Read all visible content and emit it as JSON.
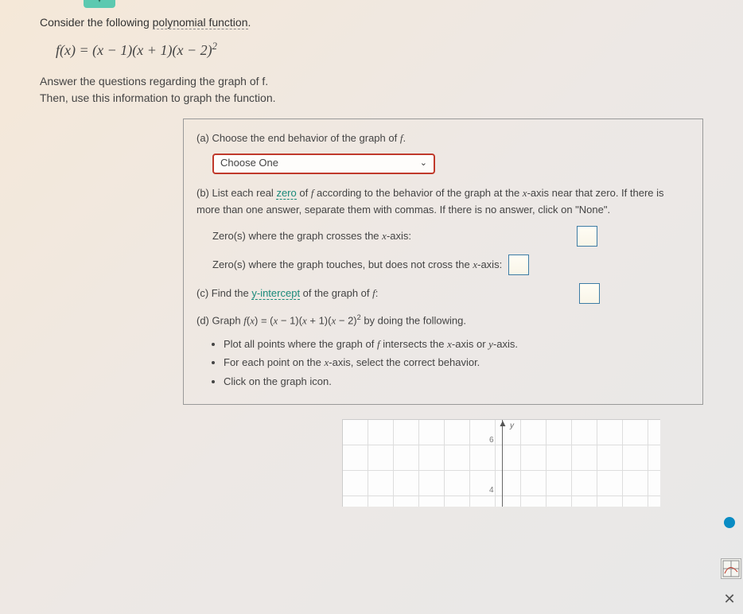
{
  "header": {
    "intro_pre": "Consider the following ",
    "intro_link": "polynomial function",
    "intro_post": "."
  },
  "equation": "f(x) = (x − 1)(x + 1)(x − 2)²",
  "instructions": {
    "line1": "Answer the questions regarding the graph of f.",
    "line2": "Then, use this information to graph the function."
  },
  "partA": {
    "label": "(a) Choose the end behavior of the graph of f.",
    "dropdown": "Choose One"
  },
  "partB": {
    "label_pre": "(b) List each real ",
    "zero_word": "zero",
    "label_post": " of f according to the behavior of the graph at the x-axis near that zero. If there is more than one answer, separate them with commas. If there is no answer, click on \"None\".",
    "crosses": "Zero(s) where the graph crosses the x-axis:",
    "touches": "Zero(s) where the graph touches, but does not cross the x-axis:"
  },
  "partC": {
    "pre": "(c) Find the ",
    "term": "y-intercept",
    "post": " of the graph of f:"
  },
  "partD": {
    "label_pre": "(d) Graph ",
    "equation": "f(x) = (x − 1)(x + 1)(x − 2)²",
    "label_post": " by doing the following.",
    "bullet1": "Plot all points where the graph of f intersects the x-axis or y-axis.",
    "bullet2": "For each point on the x-axis, select the correct behavior.",
    "bullet3": "Click on the graph icon."
  },
  "graph": {
    "y_label": "y",
    "tick6": "6",
    "tick4": "4"
  },
  "tools": {
    "close": "✕"
  }
}
